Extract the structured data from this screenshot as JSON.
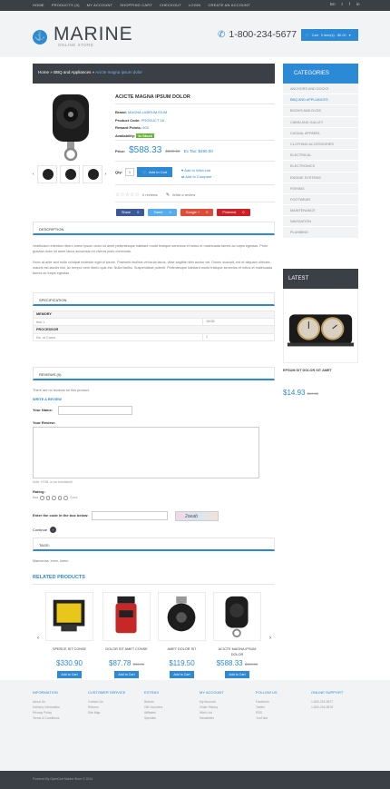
{
  "topbar": {
    "links": [
      "Home",
      "Products (0)",
      "My Account",
      "Shopping Cart",
      "Checkout",
      "Login",
      "Create an Account"
    ],
    "lang": "En",
    "social": [
      "t",
      "f",
      "in"
    ]
  },
  "brand": {
    "name": "MARINE",
    "tagline": "ONLINE STORE"
  },
  "header": {
    "phone": "1-800-234-5677",
    "cart_label": "Cart",
    "cart_summary": "0 item(s) - $0.00"
  },
  "breadcrumb": {
    "home": "Home",
    "sep1": "»",
    "parent": "BBQ and Appliances",
    "sep2": "»",
    "current": "Acicte magna ipsum dolor"
  },
  "product": {
    "title": "ACICTE MAGNA IPSUM DOLOR",
    "brand_label": "Brand:",
    "brand_value": "MAGNA LABRUM EIUM",
    "code_label": "Product Code:",
    "code_value": "PRODUCT 18",
    "points_label": "Reward Points:",
    "points_value": "600",
    "avail_label": "Availability:",
    "avail_value": "In Stock",
    "price_label": "Price:",
    "price": "$588.33",
    "old_price": "$589.50",
    "tax": "Ex Tax: $490.00",
    "qty_label": "Qty:",
    "qty": "1",
    "add_label": "Add to Cart",
    "wishlist": "Add to Wish List",
    "compare": "Add to Compare",
    "reviews_count": "0 reviews",
    "write_review": "Write a review",
    "share": [
      "Share",
      "Tweet",
      "Google +",
      "Pinterest"
    ],
    "share_counts": [
      "0",
      "0",
      "0",
      "0"
    ]
  },
  "tabs": {
    "description": "DESCRIPTION",
    "specification": "SPECIFICATION",
    "reviews": "REVIEWS (0)",
    "tags": "TAGS:"
  },
  "description": {
    "p1": "Vestibulum interdum libero lorem ipsum dolor sit amet pellentesque habitant morbi tristique senectus et netus et malesuada fames ac turpis egestas. Proin gravida dolor sit amet lacus accumsan et viverra justo commodo.",
    "p2": "Nunc at ante sed nulla volutpat molestie eget id ipsum. Praesent facilisis vehicula lacus, vitae sagittis nibh auctor vel. Donec suscipit, est et aliquam ultricies, mauris est iaculis nisi, ac tempor sem libero quis est. Nulla facilisi. Suspendisse potenti. Pellentesque habitant morbi tristique senectus et netus et malesuada fames ac turpis egestas."
  },
  "specs": [
    {
      "group": "MEMORY",
      "rows": [
        {
          "k": "test 1",
          "v": "16GB"
        }
      ]
    },
    {
      "group": "PROCESSOR",
      "rows": [
        {
          "k": "No. of Cores",
          "v": "1"
        }
      ]
    }
  ],
  "reviews": {
    "none_text": "There are no reviews for this product.",
    "write_title": "WRITE A REVIEW",
    "name_label": "Your Name:",
    "review_label": "Your Review:",
    "note": "Note: HTML is not translated!",
    "rating_label": "Rating:",
    "bad": "Bad",
    "good": "Good",
    "code_label": "Enter the code in the box below:",
    "captcha": "2oeab",
    "continue": "Continue"
  },
  "tags": {
    "text": "Maecenas, enim, lorem"
  },
  "related": {
    "heading": "RELATED PRODUCTS",
    "items": [
      {
        "name": "SPERCE SIT CONSE",
        "price": "$330.90",
        "old": "",
        "add": "Add to Cart"
      },
      {
        "name": "DOLOR SIT AMET CONSE",
        "price": "$87.78",
        "old": "$96.00",
        "add": "Add to Cart"
      },
      {
        "name": "AMET DOLOR SIT",
        "price": "$119.50",
        "old": "",
        "add": "Add to Cart"
      },
      {
        "name": "ACICTE MAGNA IPSUM DOLOR",
        "price": "$588.33",
        "old": "$589.50",
        "add": "Add to Cart"
      }
    ]
  },
  "categories": {
    "heading": "CATEGORIES",
    "items": [
      "Anchors and Docks",
      "BBQ and Appliances",
      "Books and DVDs",
      "Cabin and Galley",
      "Casual Apparel",
      "Clothing Accessories",
      "Electrical",
      "Electronics",
      "Engine Systems",
      "Fishing",
      "Footwear",
      "Maintenance",
      "Navigation",
      "Plumbing"
    ],
    "active_index": 1
  },
  "latest": {
    "heading": "LATEST",
    "name": "EPSUM SIT DOLOR SIT AMET",
    "price": "$14.93",
    "old": "$17.53"
  },
  "footer": {
    "columns": [
      {
        "title": "Information",
        "links": [
          "About Us",
          "Delivery Information",
          "Privacy Policy",
          "Terms & Conditions"
        ]
      },
      {
        "title": "Customer Service",
        "links": [
          "Contact Us",
          "Returns",
          "Site Map"
        ]
      },
      {
        "title": "Extras",
        "links": [
          "Brands",
          "Gift Vouchers",
          "Affiliates",
          "Specials"
        ]
      },
      {
        "title": "My Account",
        "links": [
          "My Account",
          "Order History",
          "Wish List",
          "Newsletter"
        ]
      },
      {
        "title": "Follow Us",
        "links": [
          "Facebook",
          "Twitter",
          "RSS",
          "YouTube"
        ]
      },
      {
        "title": "Online Support",
        "links": [
          "1-800-234-5677",
          "1-800-234-5678"
        ]
      }
    ],
    "copyright": "Powered By OpenCart Marine Store © 2014"
  },
  "colors": {
    "accent": "#2b89d6",
    "dark": "#3b3f46",
    "instock": "#66b633"
  }
}
